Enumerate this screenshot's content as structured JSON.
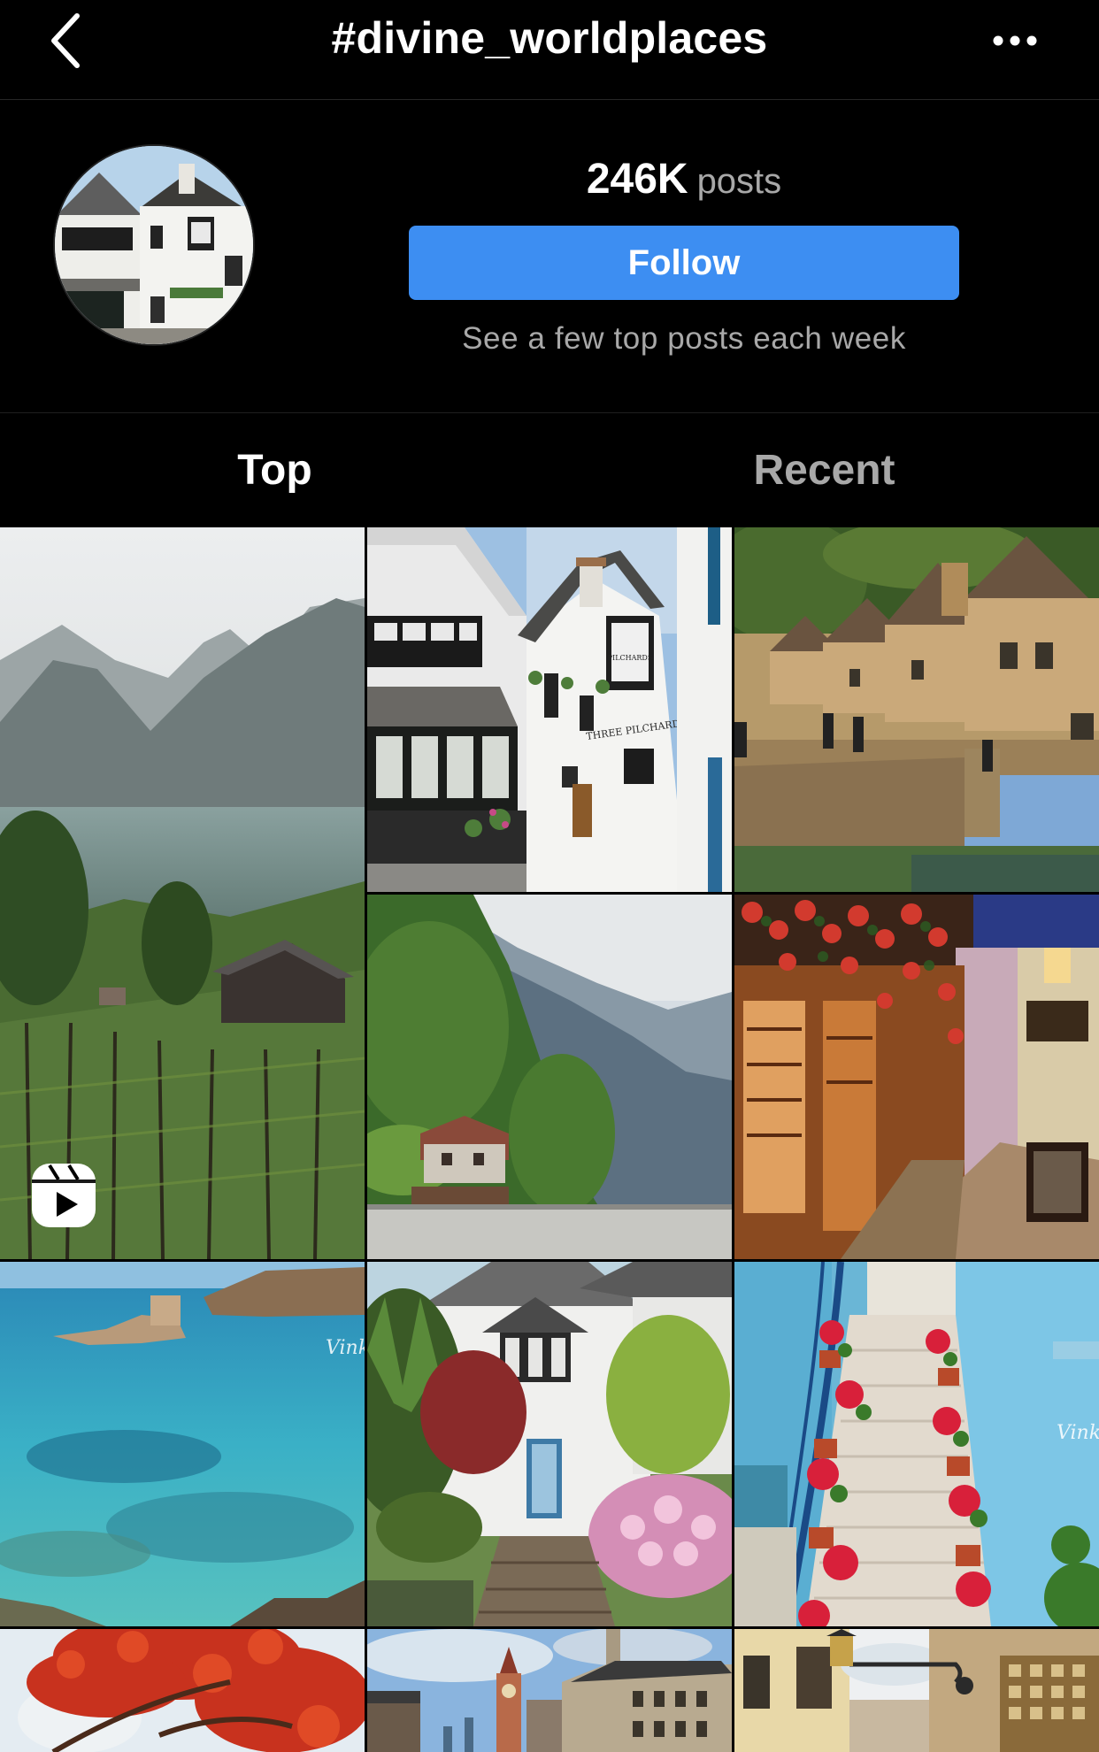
{
  "header": {
    "title": "#divine_worldplaces",
    "back_icon": "chevron-left-icon",
    "more_icon": "more-horizontal-icon"
  },
  "profile": {
    "post_count": "246K",
    "post_label": "posts",
    "follow_label": "Follow",
    "caption": "See a few top posts each week",
    "accent_color": "#3d8ef2"
  },
  "tabs": [
    {
      "label": "Top",
      "active": true
    },
    {
      "label": "Recent",
      "active": false
    }
  ],
  "grid": {
    "posts": [
      {
        "subject": "misty mountain lake vineyard",
        "type": "reel",
        "icon": "reels-icon"
      },
      {
        "subject": "whitewashed inn three pilchards"
      },
      {
        "subject": "stone village stone bridge"
      },
      {
        "subject": "lakeside alpine house"
      },
      {
        "subject": "flowered shop street"
      },
      {
        "subject": "turquoise sea rock coast",
        "watermark": "Vink"
      },
      {
        "subject": "white cottage garden hydrangeas"
      },
      {
        "subject": "blue walls stairway flowers",
        "watermark": "Vink"
      },
      {
        "subject": "red autumn tree"
      },
      {
        "subject": "european town square"
      },
      {
        "subject": "old town lantern street"
      }
    ]
  },
  "signs": {
    "inn_name": "THREE PILCHARDS"
  }
}
